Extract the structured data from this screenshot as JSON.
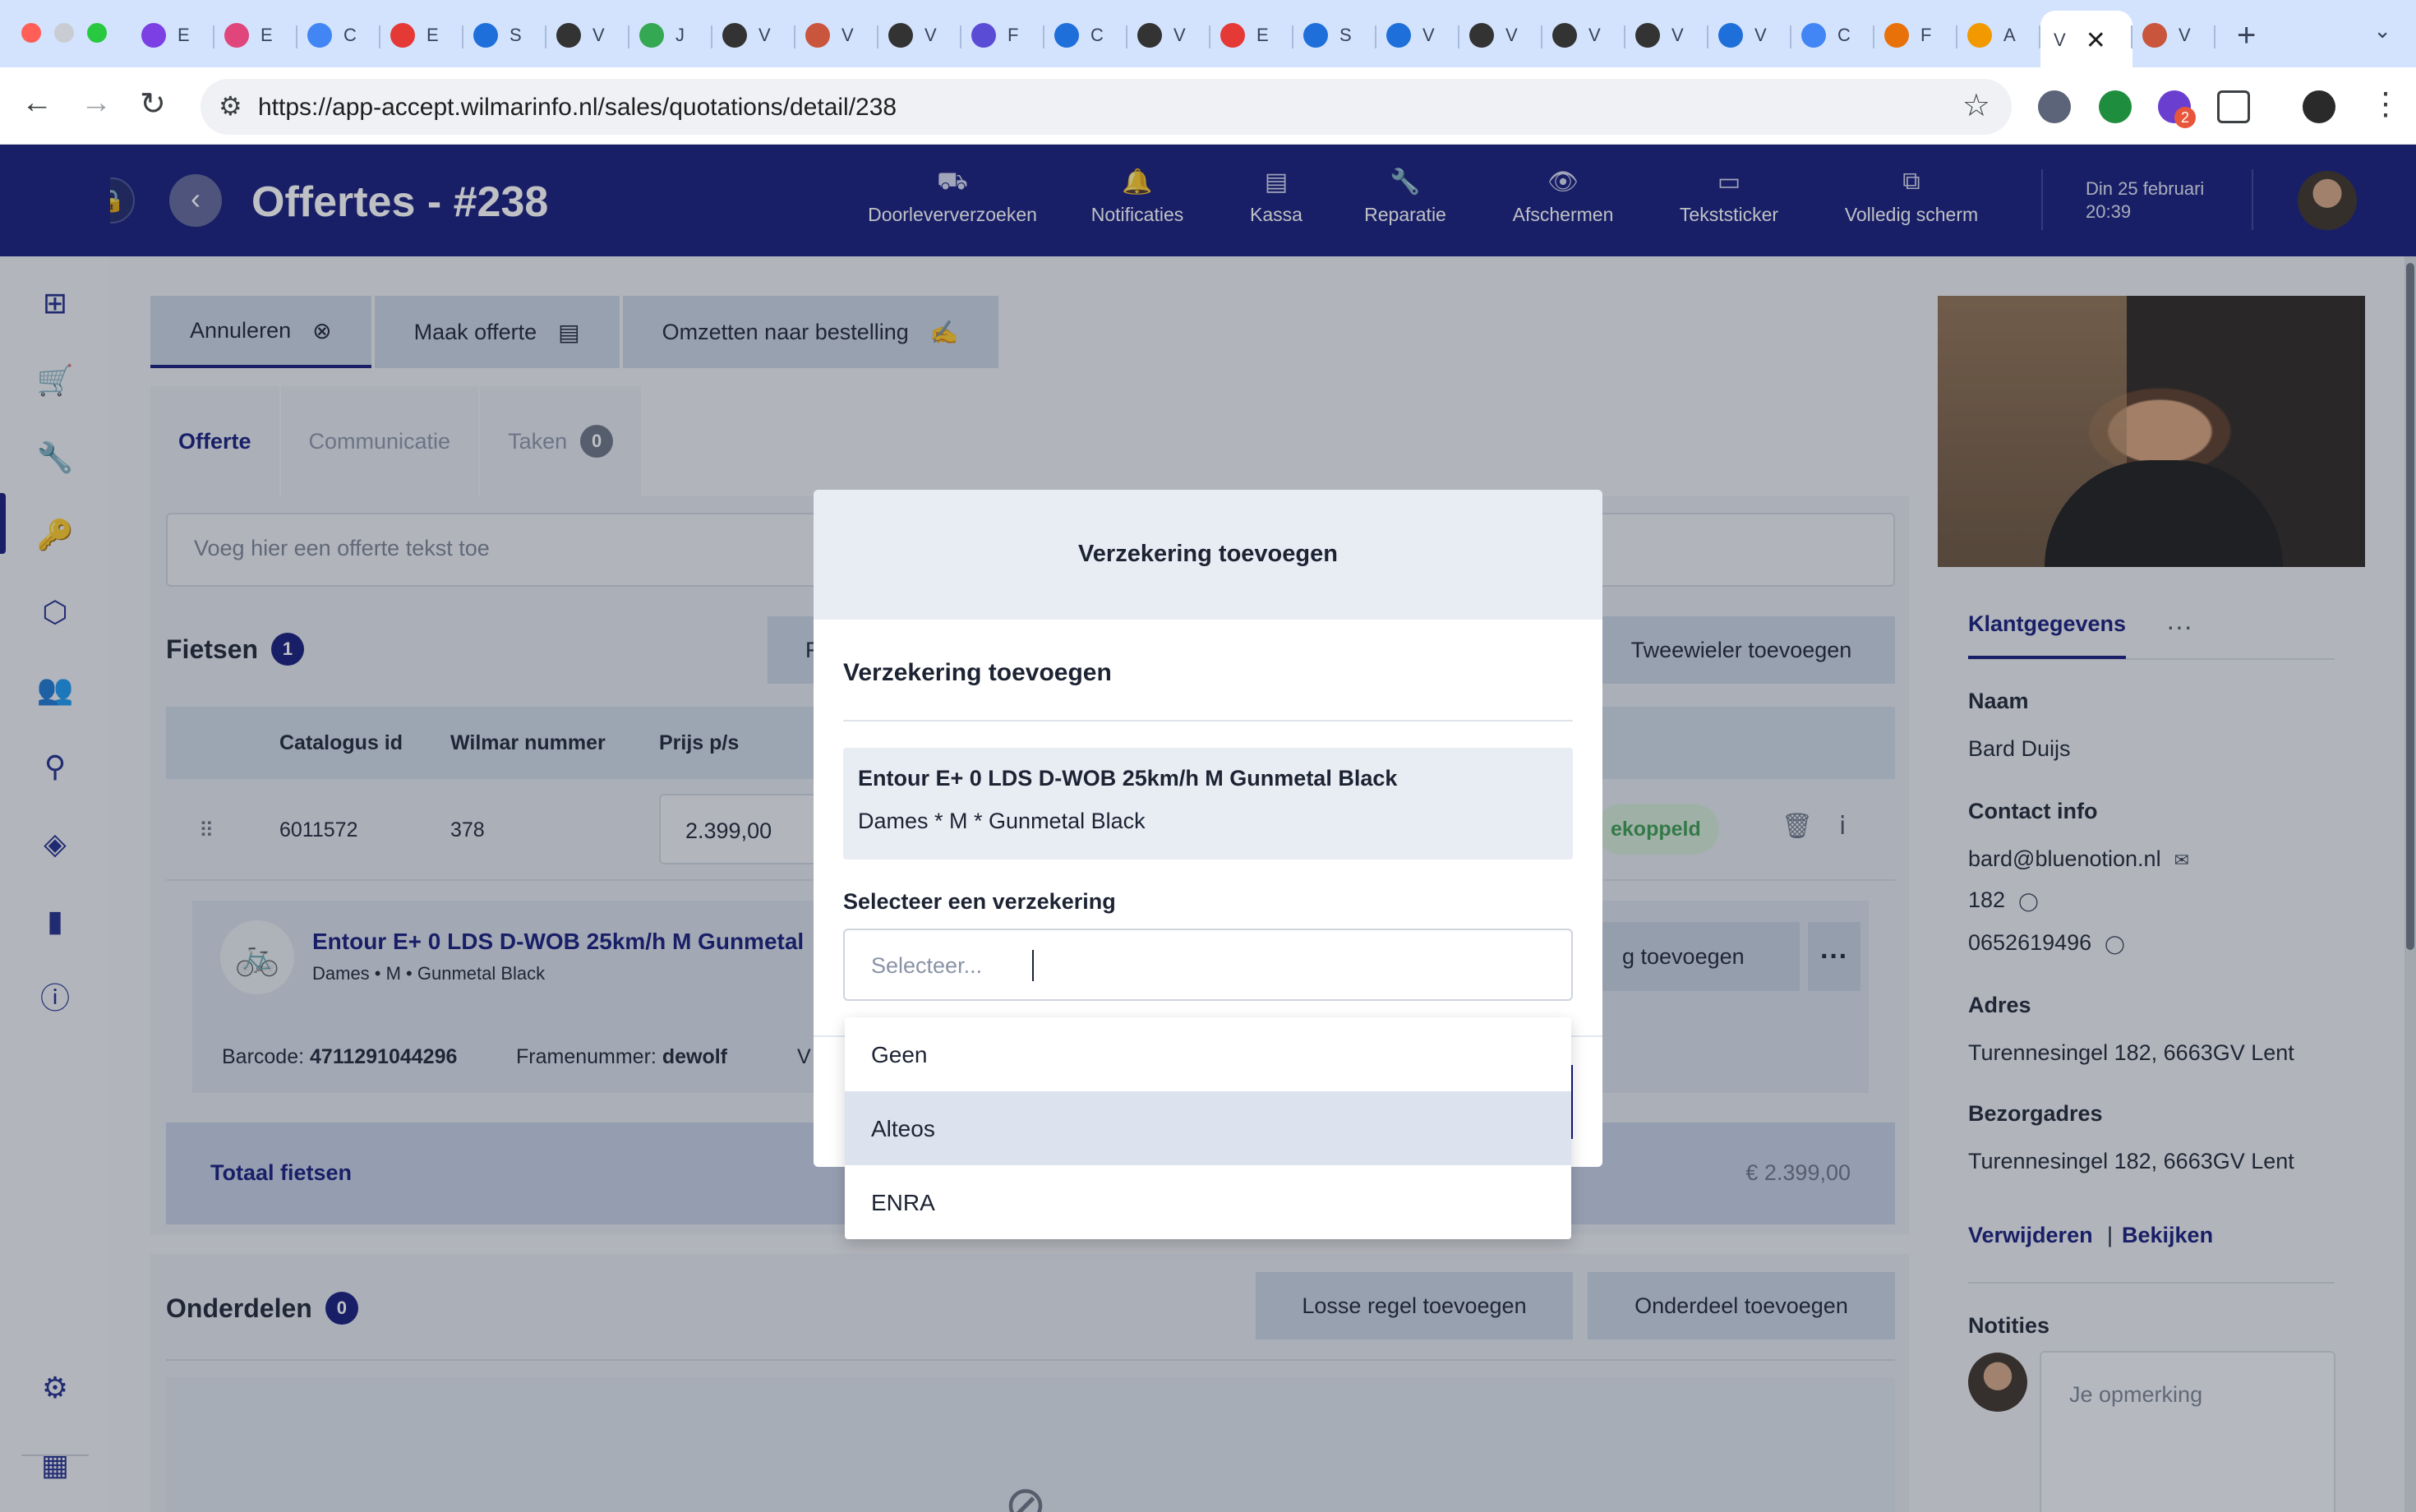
{
  "browser": {
    "tabs": [
      {
        "icon": "tab-favicon-1",
        "label": "E"
      },
      {
        "icon": "tab-favicon-2",
        "label": "E"
      },
      {
        "icon": "tab-favicon-3",
        "label": "C"
      },
      {
        "icon": "tab-favicon-4",
        "label": "E"
      },
      {
        "icon": "tab-favicon-5",
        "label": "S"
      },
      {
        "icon": "tab-favicon-6",
        "label": "V"
      },
      {
        "icon": "tab-favicon-7",
        "label": "J"
      },
      {
        "icon": "tab-favicon-8",
        "label": "V"
      },
      {
        "icon": "tab-favicon-9",
        "label": "V"
      },
      {
        "icon": "tab-favicon-10",
        "label": "V"
      },
      {
        "icon": "tab-favicon-11",
        "label": "F"
      },
      {
        "icon": "tab-favicon-12",
        "label": "C"
      },
      {
        "icon": "tab-favicon-13",
        "label": "V"
      },
      {
        "icon": "tab-favicon-14",
        "label": "E"
      },
      {
        "icon": "tab-favicon-15",
        "label": "S"
      },
      {
        "icon": "tab-favicon-16",
        "label": "V"
      },
      {
        "icon": "tab-favicon-17",
        "label": "V"
      },
      {
        "icon": "tab-favicon-18",
        "label": "V"
      },
      {
        "icon": "tab-favicon-19",
        "label": "V"
      },
      {
        "icon": "tab-favicon-20",
        "label": "V"
      },
      {
        "icon": "tab-favicon-21",
        "label": "C"
      },
      {
        "icon": "tab-favicon-22",
        "label": "F"
      },
      {
        "icon": "tab-favicon-23",
        "label": "A"
      }
    ],
    "active_tab_label": "V",
    "active_tab_close": "✕",
    "last_tab_label": "V",
    "new_tab": "+",
    "tab_menu": "⌄",
    "url": "https://app-accept.wilmarinfo.nl/sales/quotations/detail/238",
    "extension_badge": "2",
    "colors": {
      "tabstrip": "#d3e3fd",
      "accent": "#13197a"
    }
  },
  "header": {
    "logo": "V",
    "title": "Offertes - #238",
    "nav": [
      {
        "icon": "truck-icon",
        "glyph": "⛟",
        "label": "Doorleververzoeken"
      },
      {
        "icon": "bell-icon",
        "glyph": "🔔",
        "label": "Notificaties"
      },
      {
        "icon": "register-icon",
        "glyph": "▤",
        "label": "Kassa"
      },
      {
        "icon": "wrench-icon",
        "glyph": "🔧",
        "label": "Reparatie"
      },
      {
        "icon": "eye-icon",
        "glyph": "👁",
        "label": "Afschermen"
      },
      {
        "icon": "sticker-icon",
        "glyph": "▭",
        "label": "Tekststicker"
      },
      {
        "icon": "fullscreen-icon",
        "glyph": "⧉",
        "label": "Volledig scherm"
      }
    ],
    "date": "Din 25 februari",
    "time": "20:39"
  },
  "sidebar": {
    "items": [
      {
        "icon": "dashboard-icon",
        "glyph": "⊞"
      },
      {
        "icon": "cart-icon",
        "glyph": "🛒"
      },
      {
        "icon": "wrench-icon",
        "glyph": "🔧"
      },
      {
        "icon": "key-icon",
        "glyph": "🔑"
      },
      {
        "icon": "box-icon",
        "glyph": "⬡"
      },
      {
        "icon": "users-icon",
        "glyph": "👥"
      },
      {
        "icon": "bike-icon",
        "glyph": "⚲"
      },
      {
        "icon": "tag-icon",
        "glyph": "◈"
      },
      {
        "icon": "chart-icon",
        "glyph": "▮"
      },
      {
        "icon": "alert-icon",
        "glyph": "ⓘ"
      }
    ],
    "bottom": [
      {
        "icon": "settings-icon",
        "glyph": "⚙"
      },
      {
        "icon": "store-icon",
        "glyph": "▦"
      }
    ]
  },
  "actions": {
    "cancel": "Annuleren",
    "make_quote": "Maak offerte",
    "convert": "Omzetten naar bestelling"
  },
  "content_tabs": {
    "quote": "Offerte",
    "communication": "Communicatie",
    "tasks": "Taken",
    "tasks_count": "0"
  },
  "quote_text_placeholder": "Voeg hier een offerte tekst toe",
  "bikes": {
    "title": "Fietsen",
    "count": "1",
    "add_button": "Tweewieler toevoegen",
    "partial_button": "F",
    "columns": [
      "Catalogus id",
      "Wilmar nummer",
      "Prijs p/s"
    ],
    "row": {
      "catalog_id": "6011572",
      "wilmar_number": "378",
      "price": "2.399,00",
      "status": "ekoppeld"
    },
    "item": {
      "name": "Entour E+ 0 LDS D-WOB 25km/h M Gunmetal",
      "details": "Dames • M • Gunmetal Black",
      "add_button": "g toevoegen",
      "more": "···",
      "barcode_label": "Barcode:",
      "barcode": "4711291044296",
      "frame_label": "Framenummer:",
      "frame": "dewolf",
      "extra": "V"
    },
    "total_label": "Totaal fietsen",
    "total_value": "€ 2.399,00"
  },
  "parts": {
    "title": "Onderdelen",
    "count": "0",
    "loose_button": "Losse regel toevoegen",
    "add_button": "Onderdeel toevoegen"
  },
  "customer": {
    "tab": "Klantgegevens",
    "more": "···",
    "name_label": "Naam",
    "name": "Bard Duijs",
    "contact_label": "Contact info",
    "email": "bard@bluenotion.nl",
    "phone1": "182",
    "phone2": "0652619496",
    "address_label": "Adres",
    "address": "Turennesingel 182, 6663GV Lent",
    "delivery_label": "Bezorgadres",
    "delivery": "Turennesingel 182, 6663GV Lent",
    "remove": "Verwijderen",
    "separator": "|",
    "view": "Bekijken",
    "notes_label": "Notities",
    "note_placeholder": "Je opmerking"
  },
  "modal": {
    "header": "Verzekering toevoegen",
    "subtitle": "Verzekering toevoegen",
    "product_name": "Entour E+ 0 LDS D-WOB 25km/h M Gunmetal Black",
    "product_details": "Dames * M * Gunmetal Black",
    "select_label": "Selecteer een verzekering",
    "select_placeholder": "Selecteer...",
    "options": [
      "Geen",
      "Alteos",
      "ENRA"
    ],
    "highlighted_option": "Alteos"
  }
}
